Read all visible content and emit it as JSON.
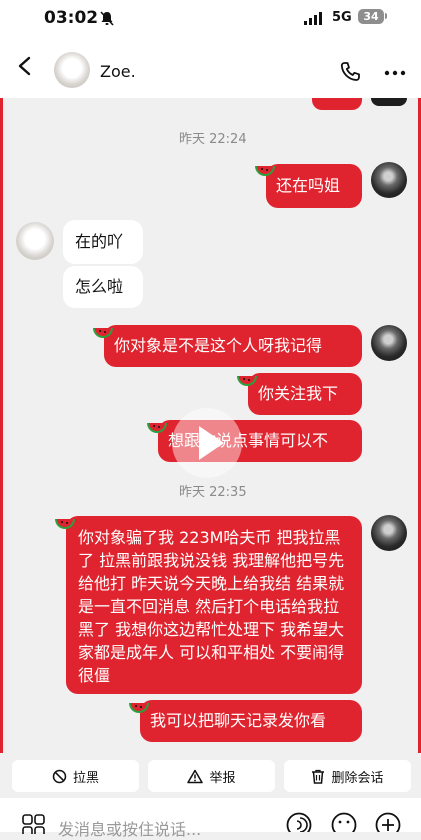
{
  "status": {
    "time": "03:02",
    "network": "5G",
    "battery": "34"
  },
  "header": {
    "contact_name": "Zoe."
  },
  "messages": [
    {
      "type": "timestamp",
      "text": "昨天 22:24"
    },
    {
      "side": "right",
      "text": "还在吗姐"
    },
    {
      "side": "left",
      "text": "在的吖"
    },
    {
      "side": "left",
      "text": "怎么啦"
    },
    {
      "side": "right",
      "text": "你对象是不是这个人呀我记得"
    },
    {
      "side": "right",
      "text": "你关注我下"
    },
    {
      "side": "right",
      "text": "想跟你说点事情可以不"
    },
    {
      "type": "timestamp",
      "text": "昨天 22:35"
    },
    {
      "side": "right",
      "text": "你对象骗了我 223M哈夫币 把我拉黑了 拉黑前跟我说没钱 我理解他把号先给他打 昨天说今天晚上给我结 结果就是一直不回消息 然后打个电话给我拉黑了 我想你这边帮忙处理下 我希望大家都是成年人 可以和平相处 不要闹得很僵"
    },
    {
      "side": "right",
      "text": "我可以把聊天记录发你看"
    }
  ],
  "actions": {
    "block": "拉黑",
    "report": "举报",
    "delete": "删除会话"
  },
  "input": {
    "placeholder": "发消息或按住说话..."
  },
  "colors": {
    "bubble_red": "#e0242f",
    "background": "#f0f0f0"
  }
}
